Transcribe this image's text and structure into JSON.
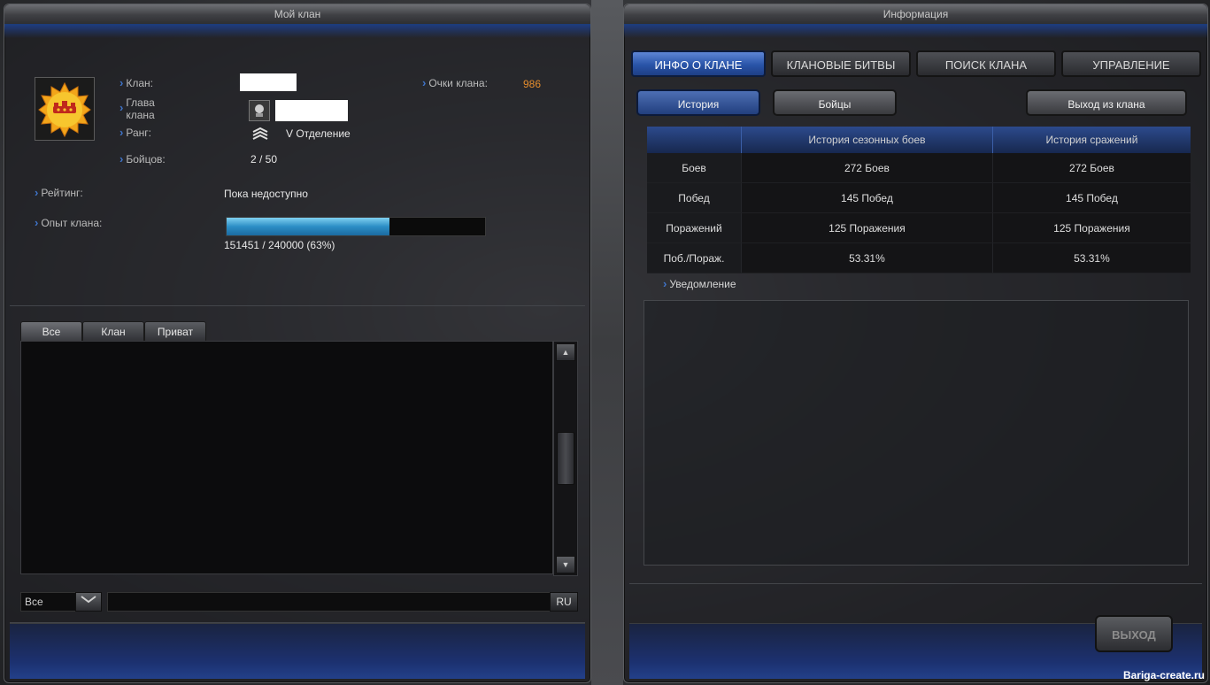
{
  "left_panel": {
    "title": "Мой клан",
    "clan_info": {
      "clan_label": "Клан:",
      "leader_label_line1": "Глава",
      "leader_label_line2": "клана",
      "rank_label": "Ранг:",
      "rank_value": "V Отделение",
      "fighters_label": "Бойцов:",
      "fighters_value": "2 / 50",
      "points_label": "Очки клана:",
      "points_value": "986",
      "rating_label": "Рейтинг:",
      "rating_value": "Пока недоступно",
      "xp_label": "Опыт клана:",
      "xp_progress": 0.63,
      "xp_text": "151451 / 240000 (63%)"
    },
    "chat": {
      "tabs": [
        "Все",
        "Клан",
        "Приват"
      ],
      "channel_select": "Все",
      "lang": "RU"
    }
  },
  "right_panel": {
    "title": "Информация",
    "tabs": [
      "ИНФО О КЛАНЕ",
      "КЛАНОВЫЕ БИТВЫ",
      "ПОИСК КЛАНА",
      "УПРАВЛЕНИЕ"
    ],
    "subtabs": {
      "history": "История",
      "fighters": "Бойцы",
      "leave": "Выход из клана"
    },
    "table": {
      "headers": [
        "",
        "История сезонных боев",
        "История сражений"
      ],
      "rows": [
        [
          "Боев",
          "272 Боев",
          "272 Боев"
        ],
        [
          "Побед",
          "145 Побед",
          "145 Побед"
        ],
        [
          "Поражений",
          "125 Поражения",
          "125 Поражения"
        ],
        [
          "Поб./Пораж.",
          "53.31%",
          "53.31%"
        ]
      ]
    },
    "notice_label": "Уведомление",
    "exit_button": "ВЫХОД"
  },
  "watermark": "Bariga-create.ru",
  "colors": {
    "accent_blue": "#2954a8",
    "points_orange": "#e58d2d",
    "xp_blue": "#2c8ec6"
  }
}
